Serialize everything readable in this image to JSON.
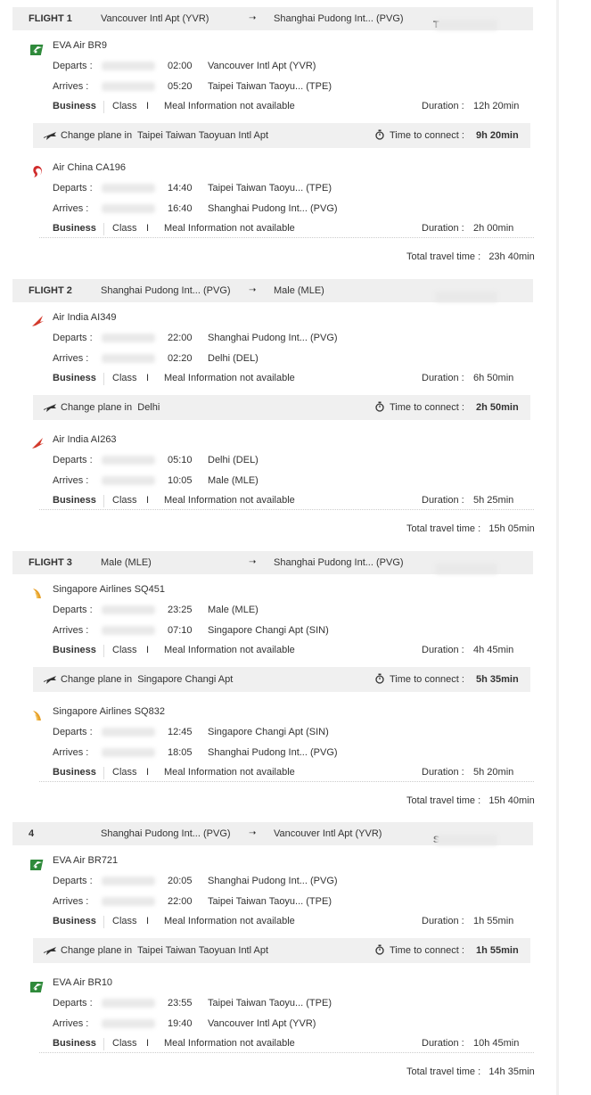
{
  "labels": {
    "departs": "Departs :",
    "arrives": "Arrives :",
    "class_word": "Class",
    "class_code": "I",
    "meal": "Meal Information not available",
    "duration": "Duration :",
    "change_prefix": "Change plane in",
    "time_to_connect": "Time to connect :",
    "total_travel_time": "Total travel time :",
    "arrow": "➝"
  },
  "flights": [
    {
      "number": "FLIGHT 1",
      "from": "Vancouver Intl Apt (YVR)",
      "to": "Shanghai Pudong Int... (PVG)",
      "date_visible": "T",
      "segments": [
        {
          "airline": "EVA Air  BR9",
          "logo": "eva-air-logo",
          "dep_time": "02:00",
          "dep_airport": "Vancouver Intl Apt (YVR)",
          "arr_time": "05:20",
          "arr_airport": "Taipei Taiwan Taoyu... (TPE)",
          "cabin": "Business",
          "duration": "12h 20min"
        },
        {
          "airline": "Air China  CA196",
          "logo": "air-china-logo",
          "dep_time": "14:40",
          "dep_airport": "Taipei Taiwan Taoyu... (TPE)",
          "arr_time": "16:40",
          "arr_airport": "Shanghai Pudong Int... (PVG)",
          "cabin": "Business",
          "duration": "2h 00min"
        }
      ],
      "connection": {
        "place": "Taipei Taiwan Taoyuan Intl Apt",
        "time": "9h 20min"
      },
      "total": "23h 40min"
    },
    {
      "number": "FLIGHT 2",
      "from": "Shanghai Pudong Int... (PVG)",
      "to": "Male (MLE)",
      "date_visible": "",
      "segments": [
        {
          "airline": "Air India  AI349",
          "logo": "air-india-logo",
          "dep_time": "22:00",
          "dep_airport": "Shanghai Pudong Int... (PVG)",
          "arr_time": "02:20",
          "arr_airport": "Delhi (DEL)",
          "cabin": "Business",
          "duration": "6h 50min"
        },
        {
          "airline": "Air India  AI263",
          "logo": "air-india-logo",
          "dep_time": "05:10",
          "dep_airport": "Delhi (DEL)",
          "arr_time": "10:05",
          "arr_airport": "Male (MLE)",
          "cabin": "Business",
          "duration": "5h 25min"
        }
      ],
      "connection": {
        "place": "Delhi",
        "time": "2h 50min"
      },
      "total": "15h 05min"
    },
    {
      "number": "FLIGHT 3",
      "from": "Male (MLE)",
      "to": "Shanghai Pudong Int... (PVG)",
      "date_visible": "",
      "segments": [
        {
          "airline": "Singapore Airlines  SQ451",
          "logo": "singapore-airlines-logo",
          "dep_time": "23:25",
          "dep_airport": "Male (MLE)",
          "arr_time": "07:10",
          "arr_airport": "Singapore Changi Apt (SIN)",
          "cabin": "Business",
          "duration": "4h 45min"
        },
        {
          "airline": "Singapore Airlines  SQ832",
          "logo": "singapore-airlines-logo",
          "dep_time": "12:45",
          "dep_airport": "Singapore Changi Apt (SIN)",
          "arr_time": "18:05",
          "arr_airport": "Shanghai Pudong Int... (PVG)",
          "cabin": "Business",
          "duration": "5h 20min"
        }
      ],
      "connection": {
        "place": "Singapore Changi Apt",
        "time": "5h 35min"
      },
      "total": "15h 40min"
    },
    {
      "number": "4",
      "from": "Shanghai Pudong Int... (PVG)",
      "to": "Vancouver Intl Apt (YVR)",
      "date_visible": "S",
      "segments": [
        {
          "airline": "EVA Air  BR721",
          "logo": "eva-air-logo",
          "dep_time": "20:05",
          "dep_airport": "Shanghai Pudong Int... (PVG)",
          "arr_time": "22:00",
          "arr_airport": "Taipei Taiwan Taoyu... (TPE)",
          "cabin": "Business",
          "duration": "1h 55min"
        },
        {
          "airline": "EVA Air  BR10",
          "logo": "eva-air-logo",
          "dep_time": "23:55",
          "dep_airport": "Taipei Taiwan Taoyu... (TPE)",
          "arr_time": "19:40",
          "arr_airport": "Vancouver Intl Apt (YVR)",
          "cabin": "Business",
          "duration": "10h 45min"
        }
      ],
      "connection": {
        "place": "Taipei Taiwan Taoyuan Intl Apt",
        "time": "1h 55min"
      },
      "total": "14h 35min"
    }
  ]
}
